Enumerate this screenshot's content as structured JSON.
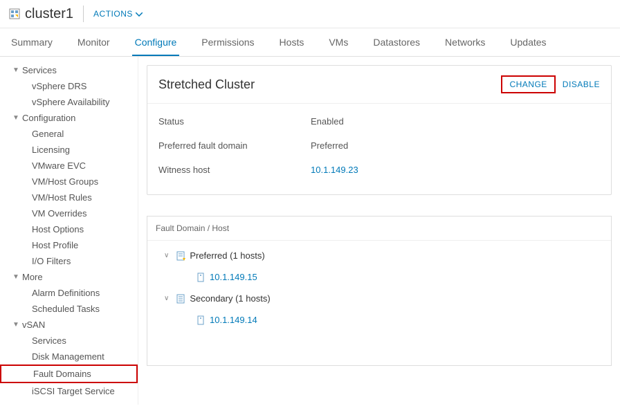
{
  "header": {
    "title": "cluster1",
    "actions_label": "ACTIONS"
  },
  "tabs": {
    "summary": "Summary",
    "monitor": "Monitor",
    "configure": "Configure",
    "permissions": "Permissions",
    "hosts": "Hosts",
    "vms": "VMs",
    "datastores": "Datastores",
    "networks": "Networks",
    "updates": "Updates"
  },
  "sidebar": {
    "services": {
      "label": "Services",
      "items": {
        "drs": "vSphere DRS",
        "availability": "vSphere Availability"
      }
    },
    "configuration": {
      "label": "Configuration",
      "items": {
        "general": "General",
        "licensing": "Licensing",
        "vmware_evc": "VMware EVC",
        "vmhost_groups": "VM/Host Groups",
        "vmhost_rules": "VM/Host Rules",
        "vm_overrides": "VM Overrides",
        "host_options": "Host Options",
        "host_profile": "Host Profile",
        "io_filters": "I/O Filters"
      }
    },
    "more": {
      "label": "More",
      "items": {
        "alarm_definitions": "Alarm Definitions",
        "scheduled_tasks": "Scheduled Tasks"
      }
    },
    "vsan": {
      "label": "vSAN",
      "items": {
        "services": "Services",
        "disk_management": "Disk Management",
        "fault_domains": "Fault Domains",
        "iscsi_target": "iSCSI Target Service"
      }
    }
  },
  "card": {
    "title": "Stretched Cluster",
    "change_btn": "CHANGE",
    "disable_btn": "DISABLE",
    "status_label": "Status",
    "status_value": "Enabled",
    "pfd_label": "Preferred fault domain",
    "pfd_value": "Preferred",
    "witness_label": "Witness host",
    "witness_value": "10.1.149.23"
  },
  "table": {
    "header": "Fault Domain / Host",
    "domain1": "Preferred (1 hosts)",
    "host1": "10.1.149.15",
    "domain2": "Secondary (1 hosts)",
    "host2": "10.1.149.14"
  }
}
